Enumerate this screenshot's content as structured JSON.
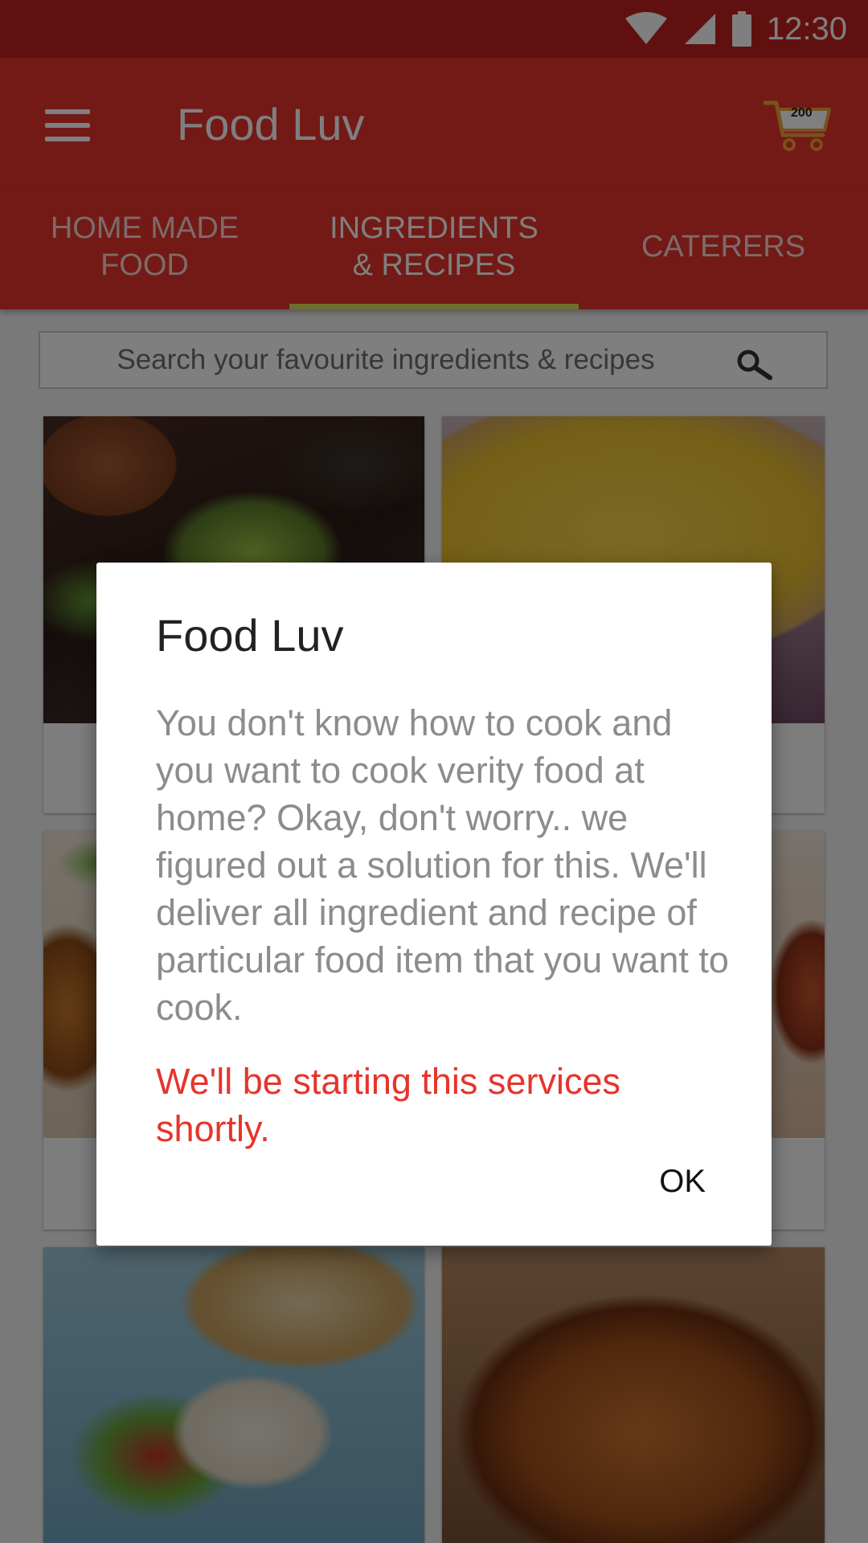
{
  "status_bar": {
    "time": "12:30",
    "icons": [
      "wifi-icon",
      "signal-icon",
      "battery-icon"
    ]
  },
  "app_bar": {
    "title": "Food Luv",
    "menu_icon": "hamburger-menu-icon",
    "cart_icon": "shopping-cart-icon",
    "cart_count": "200"
  },
  "tabs": [
    {
      "line1": "HOME MADE",
      "line2": "FOOD",
      "active": false
    },
    {
      "line1": "INGREDIENTS",
      "line2": "& RECIPES",
      "active": true
    },
    {
      "line1": "CATERERS",
      "line2": "",
      "active": false
    }
  ],
  "search": {
    "placeholder": "Search your favourite ingredients & recipes",
    "icon": "search-icon"
  },
  "dialog": {
    "title": "Food Luv",
    "body": "You don't know how to cook and you want to cook verity food at home? Okay, don't worry.. we figured out a solution for this. We'll deliver all ingredient and recipe of particular food item that you want to cook.",
    "notice": "We'll be starting this services shortly.",
    "ok_label": "OK"
  },
  "colors": {
    "primary": "#e6342c",
    "primary_dark": "#c0231f",
    "tab_indicator": "#d8e05a",
    "notice_text": "#e6342c"
  }
}
